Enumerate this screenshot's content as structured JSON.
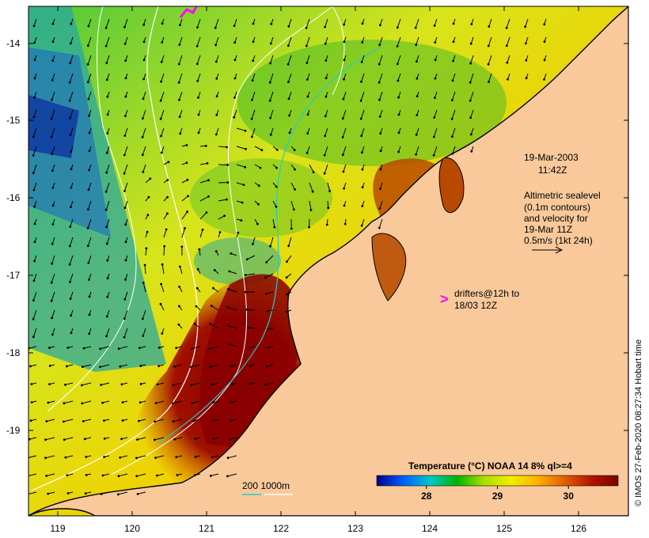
{
  "map": {
    "y_ticks": [
      "-14",
      "-15",
      "-16",
      "-17",
      "-18",
      "-19"
    ],
    "x_ticks": [
      "119",
      "120",
      "121",
      "122",
      "123",
      "124",
      "125",
      "126"
    ],
    "date": "19-Mar-2003",
    "time": "11:42Z",
    "legend_lines": [
      "Altimetric sealevel",
      "(0.1m contours)",
      "and velocity for",
      "19-Mar 11Z",
      "0.5m/s (1kt 24h)"
    ],
    "drifter_marker": ">",
    "drifter_line1": "drifters@12h to",
    "drifter_line2": "18/03 12Z",
    "depth_legend": "200  1000m",
    "credit": "© IMOS 27-Feb-2020 08:27:34 Hobart time",
    "colors": {
      "land": "#f9c99b",
      "coast": "#000000",
      "drifter": "#ff00ff",
      "contour_200": "#22cccc",
      "contour_1000": "#ffffff"
    }
  },
  "colorbar": {
    "title": "Temperature (°C) NOAA 14 8% ql>=4",
    "ticks": [
      "28",
      "29",
      "30"
    ],
    "tick_values": [
      28,
      29,
      30
    ],
    "range": [
      27.3,
      30.7
    ],
    "stops": [
      "#00008b",
      "#0060ff",
      "#00c8c8",
      "#00b400",
      "#a8e000",
      "#f0f000",
      "#ffb000",
      "#e06000",
      "#b41400",
      "#7a0000"
    ]
  }
}
